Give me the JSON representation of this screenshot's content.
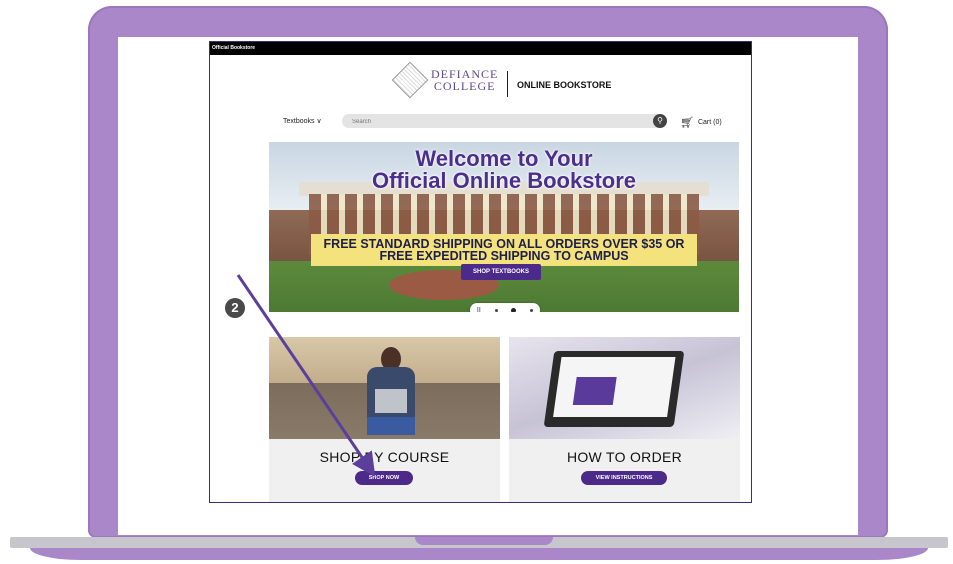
{
  "site": {
    "topbar_text": "Official Bookstore",
    "logo_line1": "DEFIANCE",
    "logo_line2": "COLLEGE",
    "store_title": "ONLINE BOOKSTORE"
  },
  "nav": {
    "textbooks_label": "Textbooks ∨",
    "search_placeholder": "Search",
    "search_icon": "search-icon",
    "cart_label": "Cart (0)",
    "cart_icon": "cart-icon"
  },
  "hero": {
    "title_line1": "Welcome to Your",
    "title_line2": "Official Online Bookstore",
    "banner_line1": "FREE STANDARD SHIPPING ON ALL ORDERS OVER $35 OR",
    "banner_line2": "FREE EXPEDITED SHIPPING TO CAMPUS",
    "button_label": "SHOP TEXTBOOKS",
    "carousel_pause": "II"
  },
  "cards": [
    {
      "title": "SHOP BY COURSE",
      "button_label": "SHOP NOW"
    },
    {
      "title": "HOW TO ORDER",
      "button_label": "VIEW INSTRUCTIONS"
    }
  ],
  "annotation": {
    "step_number": "2",
    "arrow_color": "#5b3f9a"
  },
  "colors": {
    "laptop_frame": "#a987c9",
    "brand_purple": "#4b2a8a",
    "banner_yellow": "#f4e27c"
  }
}
